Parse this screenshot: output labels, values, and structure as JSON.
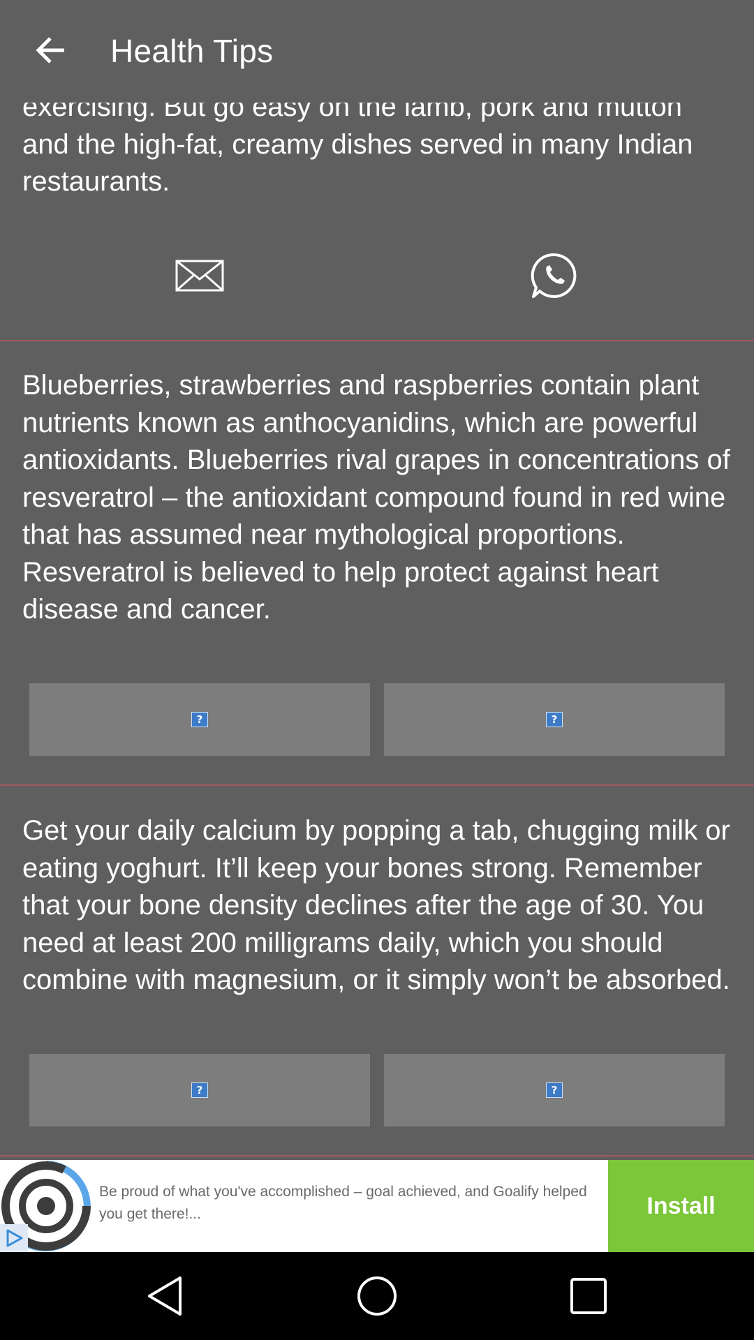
{
  "header": {
    "title": "Health Tips",
    "back_icon": "arrow-left-icon"
  },
  "tips": [
    {
      "text": "exercising. But go easy on the lamb, pork and mutton and the high-fat, creamy dishes served in many Indian restaurants.",
      "actions": [
        "envelope-icon",
        "whatsapp-icon"
      ]
    },
    {
      "text": "Blueberries, strawberries and raspberries contain plant nutrients known as anthocyanidins, which are powerful antioxidants. Blueberries rival grapes in concentrations of resveratrol – the antioxidant compound found in red wine that has assumed near mythological proportions. Resveratrol is believed to help protect against heart disease and cancer.",
      "actions": [
        "broken-image-icon",
        "broken-image-icon"
      ]
    },
    {
      "text": "Get your daily calcium by popping a tab, chugging milk or eating yoghurt. It’ll keep your bones strong. Remember that your bone density declines after the age of 30. You need at least 200 milligrams daily, which you should combine with magnesium, or it simply won’t be absorbed.",
      "actions": [
        "broken-image-icon",
        "broken-image-icon"
      ]
    }
  ],
  "ad": {
    "text": "Be proud of what you've accomplished – goal achieved, and Goalify helped you get there!...",
    "install_label": "Install"
  },
  "navbar": {
    "back_icon": "nav-back-icon",
    "home_icon": "nav-home-icon",
    "recents_icon": "nav-recents-icon"
  },
  "colors": {
    "background": "#5f5f5f",
    "divider": "#a35a5c",
    "button": "#7d7d7d",
    "install": "#7cc63a"
  }
}
